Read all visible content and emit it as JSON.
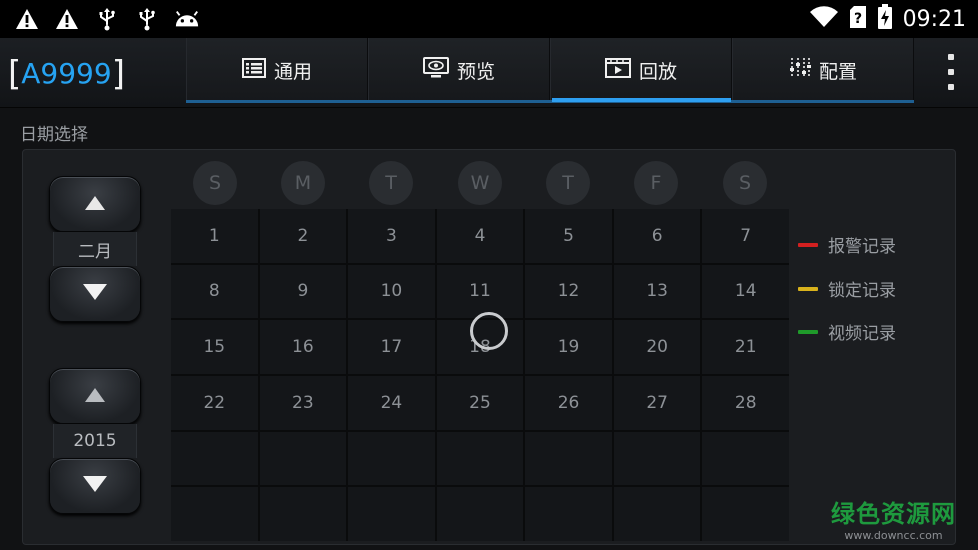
{
  "status_bar": {
    "left_icons": [
      "warning-icon",
      "warning-icon",
      "usb-icon",
      "usb-icon",
      "android-icon"
    ],
    "right_icons": [
      "wifi-icon",
      "sim-unknown-icon",
      "battery-charging-icon"
    ],
    "time": "09:21"
  },
  "app": {
    "device_name": "A9999",
    "tabs": [
      {
        "label": "通用",
        "icon": "general-icon",
        "active": false
      },
      {
        "label": "预览",
        "icon": "preview-icon",
        "active": false
      },
      {
        "label": "回放",
        "icon": "playback-icon",
        "active": true
      },
      {
        "label": "配置",
        "icon": "config-icon",
        "active": false
      }
    ],
    "overflow_menu": "more-vert-icon"
  },
  "date_picker": {
    "title": "日期选择",
    "month": "二月",
    "year": "2015",
    "weekdays": [
      "S",
      "M",
      "T",
      "W",
      "T",
      "F",
      "S"
    ],
    "days": [
      [
        "1",
        "2",
        "3",
        "4",
        "5",
        "6",
        "7"
      ],
      [
        "8",
        "9",
        "10",
        "11",
        "12",
        "13",
        "14"
      ],
      [
        "15",
        "16",
        "17",
        "18",
        "19",
        "20",
        "21"
      ],
      [
        "22",
        "23",
        "24",
        "25",
        "26",
        "27",
        "28"
      ],
      [
        "",
        "",
        "",
        "",
        "",
        "",
        ""
      ],
      [
        "",
        "",
        "",
        "",
        "",
        "",
        ""
      ]
    ],
    "legend": [
      {
        "label": "报警记录",
        "color": "#d32020"
      },
      {
        "label": "锁定记录",
        "color": "#d9b21c"
      },
      {
        "label": "视频记录",
        "color": "#1f9a2a"
      }
    ]
  },
  "watermark": {
    "text": "绿色资源网",
    "url": "www.downcc.com"
  },
  "colors": {
    "accent": "#2e9ff0",
    "brand_number": "#26a3f2"
  }
}
